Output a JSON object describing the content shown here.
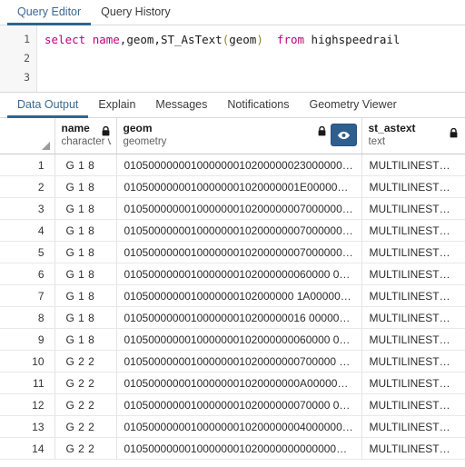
{
  "top_tabs": {
    "items": [
      {
        "label": "Query Editor",
        "active": true
      },
      {
        "label": "Query History",
        "active": false
      }
    ]
  },
  "editor": {
    "line_numbers": [
      "1",
      "2",
      "3"
    ],
    "query_text": "select name,geom,ST_AsText(geom)  from highspeedrail",
    "tokens": [
      {
        "text": "select",
        "type": "keyword"
      },
      {
        "text": " ",
        "type": "plain"
      },
      {
        "text": "name",
        "type": "keyword"
      },
      {
        "text": ",geom,",
        "type": "plain"
      },
      {
        "text": "ST_AsText",
        "type": "function"
      },
      {
        "text": "(",
        "type": "paren"
      },
      {
        "text": "geom",
        "type": "plain"
      },
      {
        "text": ")",
        "type": "paren"
      },
      {
        "text": "  ",
        "type": "plain"
      },
      {
        "text": "from",
        "type": "keyword"
      },
      {
        "text": " highspeedrail",
        "type": "plain"
      }
    ],
    "colors": {
      "keyword": "#c2007a",
      "function": "#1a1a1a",
      "paren": "#8a8a23",
      "plain": "#1a1a1a"
    }
  },
  "result_tabs": {
    "items": [
      {
        "label": "Data Output",
        "active": true
      },
      {
        "label": "Explain",
        "active": false
      },
      {
        "label": "Messages",
        "active": false
      },
      {
        "label": "Notifications",
        "active": false
      },
      {
        "label": "Geometry Viewer",
        "active": false
      }
    ]
  },
  "grid": {
    "columns": [
      {
        "name": "name",
        "type": "character v",
        "locked": true,
        "has_eye": false
      },
      {
        "name": "geom",
        "type": "geometry",
        "locked": true,
        "has_eye": true
      },
      {
        "name": "st_astext",
        "type": "text",
        "locked": true,
        "has_eye": false
      }
    ],
    "eye_button": {
      "icon": "eye-icon",
      "color": "#2f5f8d",
      "active": true
    },
    "sort_indicator": "sort-triangle-icon",
    "rows": [
      {
        "n": "1",
        "name": "G 1 8",
        "geom": "0105000000010000000102000000230000007…",
        "st_astext": "MULTILINESTRI…"
      },
      {
        "n": "2",
        "name": "G 1 8",
        "geom": "01050000000100000001020000001E0000001…",
        "st_astext": "MULTILINESTRI…"
      },
      {
        "n": "3",
        "name": "G 1 8",
        "geom": "0105000000010000000102000000070000000B…",
        "st_astext": "MULTILINESTRI…"
      },
      {
        "n": "4",
        "name": "G 1 8",
        "geom": "0105000000010000000102000000070000000B…",
        "st_astext": "MULTILINESTRI…"
      },
      {
        "n": "5",
        "name": "G 1 8",
        "geom": "010500000001000000010200000007000000…",
        "st_astext": "MULTILINESTRI…"
      },
      {
        "n": "6",
        "name": "G 1 8",
        "geom": "0105000000010000000102000000060000 0F…",
        "st_astext": "MULTILINESTRI…"
      },
      {
        "n": "7",
        "name": "G 1 8",
        "geom": "0105000000010000000102000000 1A000002…",
        "st_astext": "MULTILINESTRI…"
      },
      {
        "n": "8",
        "name": "G 1 8",
        "geom": "010500000001000000010200000016 0000007…",
        "st_astext": "MULTILINESTRI…"
      },
      {
        "n": "9",
        "name": "G 1 8",
        "geom": "0105000000010000000102000000060000 0F…",
        "st_astext": "MULTILINESTRI…"
      },
      {
        "n": "10",
        "name": "G 2 2",
        "geom": "01050000000100000001020000000700000 0F…",
        "st_astext": "MULTILINESTRI…"
      },
      {
        "n": "11",
        "name": "G 2 2",
        "geom": "01050000000100000001020000000A000000F…",
        "st_astext": "MULTILINESTRI…"
      },
      {
        "n": "12",
        "name": "G 2 2",
        "geom": "0105000000010000000102000000070000 00C…",
        "st_astext": "MULTILINESTRI…"
      },
      {
        "n": "13",
        "name": "G 2 2",
        "geom": "010500000001000000010200000004000000E…",
        "st_astext": "MULTILINESTRI…"
      },
      {
        "n": "14",
        "name": "G 2 2",
        "geom": "01050000000100000001020000000000000…",
        "st_astext": "MULTILINESTRI…"
      }
    ]
  },
  "theme": {
    "accent": "#2f6491",
    "tab_active_text": "#3a6a94",
    "grid_border": "#e3e3e3",
    "eye_button_bg": "#2f5f8d"
  }
}
